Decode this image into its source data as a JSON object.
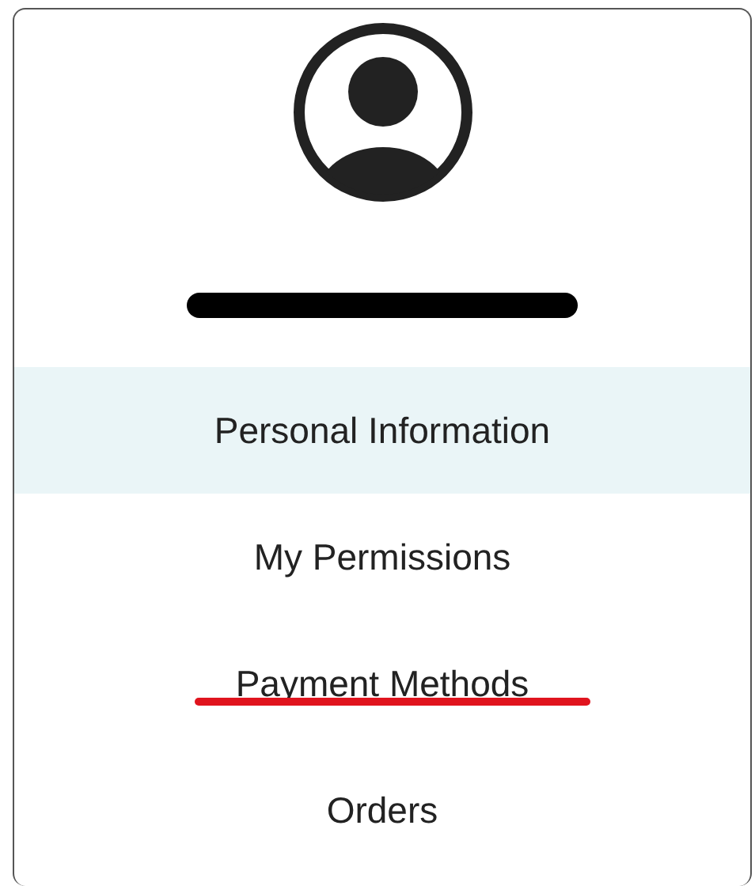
{
  "profile": {
    "name_redacted": true
  },
  "menu": [
    {
      "label": "Personal Information",
      "selected": true,
      "underlined": false
    },
    {
      "label": "My Permissions",
      "selected": false,
      "underlined": false
    },
    {
      "label": "Payment Methods",
      "selected": false,
      "underlined": true
    },
    {
      "label": "Orders",
      "selected": false,
      "underlined": false
    }
  ]
}
